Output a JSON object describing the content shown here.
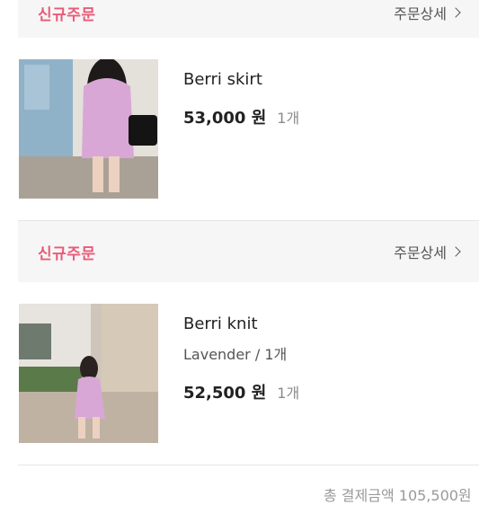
{
  "orders": [
    {
      "status": "신규주문",
      "detail_label": "주문상세",
      "item": {
        "name": "Berri skirt",
        "price": "53,000 원",
        "qty": "1개"
      }
    },
    {
      "status": "신규주문",
      "detail_label": "주문상세",
      "item": {
        "name": "Berri knit",
        "option": "Lavender / 1개",
        "price": "52,500 원",
        "qty": "1개"
      }
    }
  ],
  "total_label": "총 결제금액 105,500원",
  "colors": {
    "status": "#ea5a78",
    "header_bg": "#f6f6f6",
    "product": "#d8a7d6"
  },
  "icons": [
    "chevron-right-icon"
  ]
}
